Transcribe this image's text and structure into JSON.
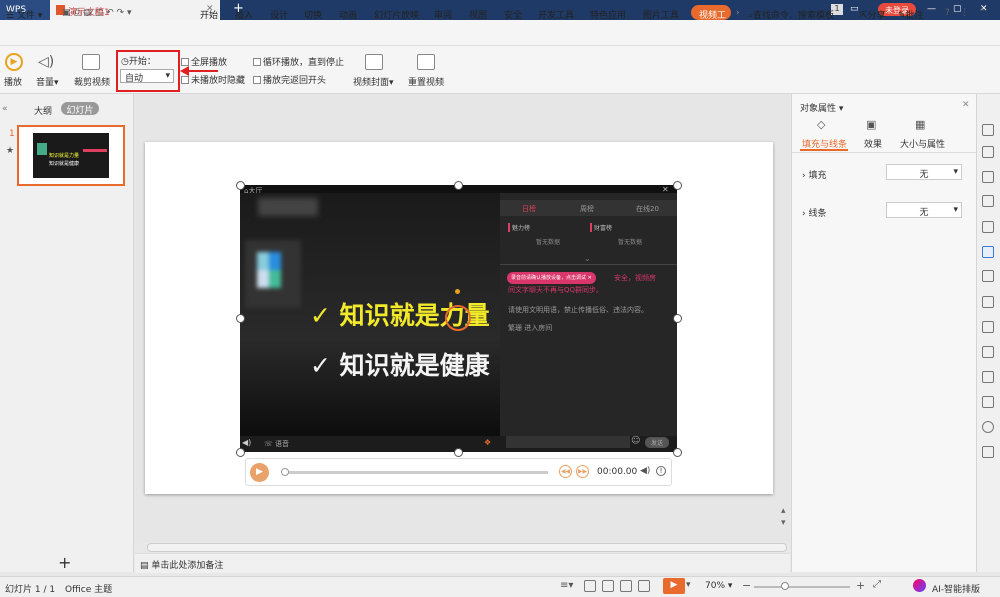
{
  "titlebar": {
    "app_label": "WPS",
    "doc_tab": "演示文稿1",
    "badge": "1",
    "login": "未登录"
  },
  "menubar": {
    "file": "文件",
    "items": [
      "开始",
      "插入",
      "设计",
      "切换",
      "动画",
      "幻灯片放映",
      "审阅",
      "视图",
      "安全",
      "开发工具",
      "特色应用",
      "图片工具"
    ],
    "active": "视频工",
    "search": "查找命令、搜索模板",
    "share": "分享",
    "comment": "批注"
  },
  "ribbon": {
    "play": "播放",
    "volume": "音量",
    "trim": "裁剪视频",
    "start_label": "开始：",
    "start_value": "自动",
    "fullscreen": "全屏播放",
    "hide_when_not_playing": "未播放时隐藏",
    "loop": "循环播放，直到停止",
    "rewind": "播放完返回开头",
    "cover": "视频封面",
    "reset": "重置视频"
  },
  "leftpanel": {
    "tab_outline": "大纲",
    "tab_slides": "幻灯片",
    "slide_number": "1",
    "add": "+"
  },
  "video": {
    "hall_label": "大厅",
    "line1": "✓ 知识就是力量",
    "line2": "✓ 知识就是健康",
    "thumb_line1": "知识就是力量",
    "thumb_line2": "知识就是健康",
    "tabs": [
      "日榜",
      "周榜",
      "在线20"
    ],
    "rank1": "魅力榜",
    "rank2": "财富榜",
    "empty1": "暂无数据",
    "empty2": "暂无数据",
    "notice_pill": "录音前请确认播放设备，点击调试",
    "notice_line1": "安全，视频房",
    "notice_line2": "间文字聊天不再与QQ群同步。",
    "rule": "请使用文明用语，禁止传播低俗、违法内容。",
    "enter": "繁珊 进入房间",
    "voice": "语音",
    "send": "发送"
  },
  "controls": {
    "time": "00:00.00"
  },
  "rightpanel": {
    "title": "对象属性",
    "tabs": [
      "填充与线条",
      "效果",
      "大小与属性"
    ],
    "fill_label": "填充",
    "fill_value": "无",
    "line_label": "线条",
    "line_value": "无"
  },
  "notes": {
    "placeholder": "单击此处添加备注"
  },
  "statusbar": {
    "slide": "幻灯片 1 / 1",
    "theme": "Office 主题",
    "zoom": "70%",
    "ai": "AI-智能排版"
  },
  "colors": {
    "accent": "#e86a2d",
    "titlebar": "#1f3a66",
    "highlight": "#e02020"
  }
}
